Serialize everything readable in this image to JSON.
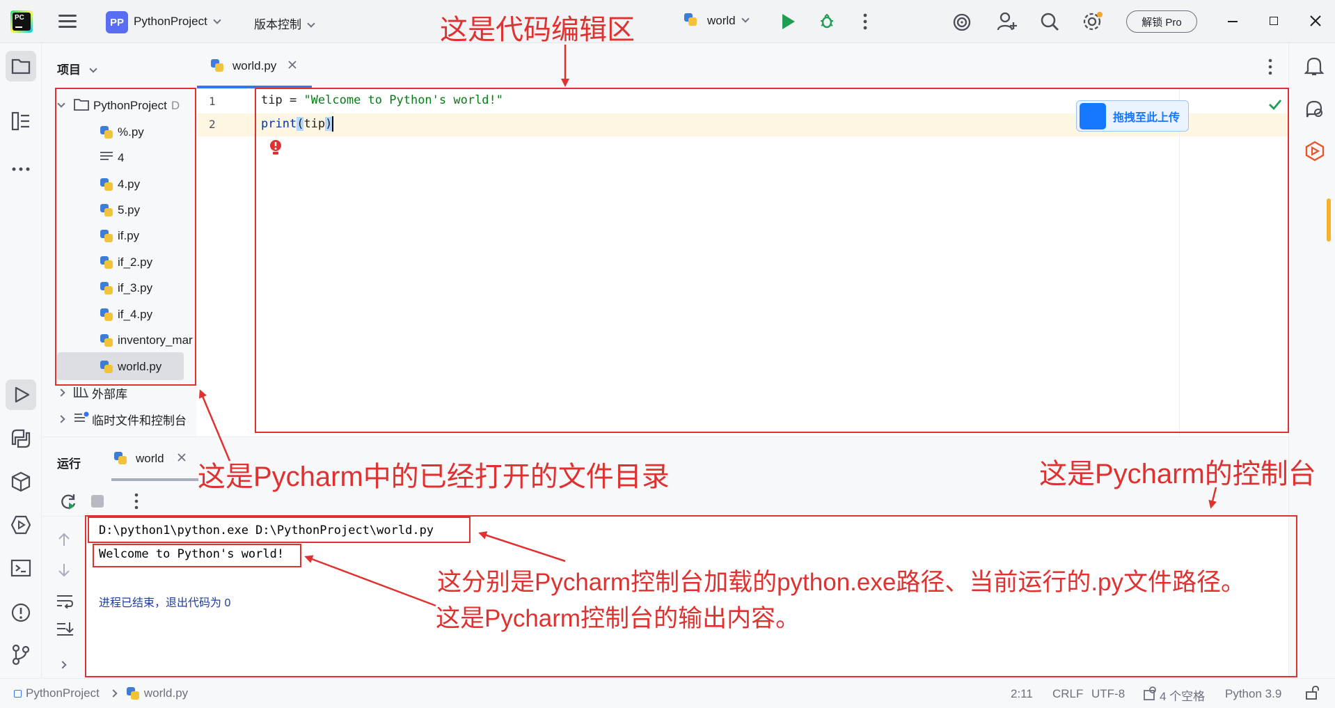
{
  "titlebar": {
    "project_badge": "PP",
    "project_name": "PythonProject",
    "vcs_menu": "版本控制",
    "run_config": "world",
    "pro_button": "解锁 Pro"
  },
  "project_panel": {
    "title": "项目",
    "root": "PythonProject",
    "root_suffix": "D",
    "files": [
      "%.py",
      "4",
      "4.py",
      "5.py",
      "if.py",
      "if_2.py",
      "if_3.py",
      "if_4.py",
      "inventory_mar",
      "world.py"
    ],
    "external_libs": "外部库",
    "scratches": "临时文件和控制台"
  },
  "editor": {
    "tab": "world.py",
    "lines": [
      {
        "num": "1",
        "var": "tip",
        "op": " = ",
        "str": "\"Welcome to Python's world!\""
      },
      {
        "num": "2",
        "fn": "print",
        "open": "(",
        "arg": "tip",
        "close": ")"
      }
    ],
    "upload_badge": "拖拽至此上传"
  },
  "run_panel": {
    "title": "运行",
    "tab": "world",
    "command": "D:\\python1\\python.exe D:\\PythonProject\\world.py",
    "output": "Welcome to Python's world!",
    "exit_message": "进程已结束，退出代码为 0"
  },
  "statusbar": {
    "project": "PythonProject",
    "file": "world.py",
    "position": "2:11",
    "line_ending": "CRLF",
    "encoding": "UTF-8",
    "indent": "4 个空格",
    "interpreter": "Python 3.9"
  },
  "annotations": {
    "editor": "这是代码编辑区",
    "file_tree": "这是Pycharm中的已经打开的文件目录",
    "console": "这是Pycharm的控制台",
    "paths": "这分别是Pycharm控制台加载的python.exe路径、当前运行的.py文件路径。",
    "output": "这是Pycharm控制台的输出内容。"
  },
  "colors": {
    "accent": "#3574f0",
    "annotation_red": "#e03131",
    "string_green": "#067d17",
    "keyword_blue": "#0033b3"
  }
}
